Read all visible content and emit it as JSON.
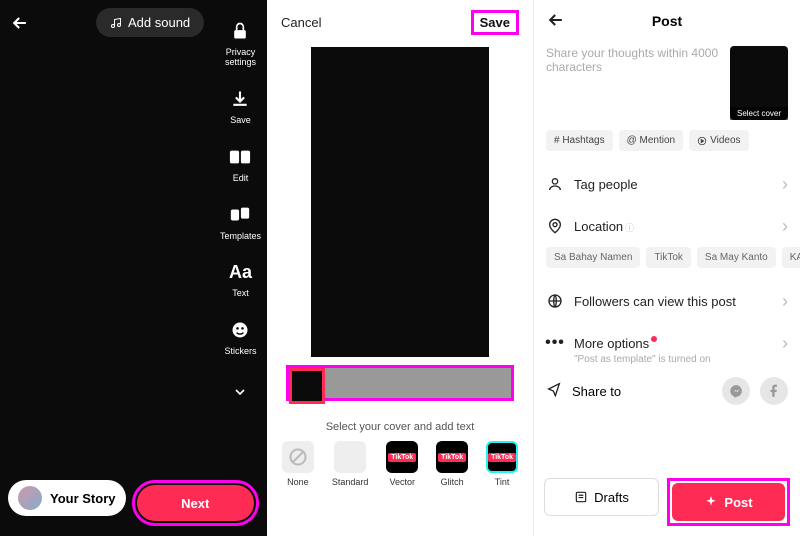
{
  "editor": {
    "add_sound": "Add sound",
    "sidebar": [
      {
        "icon": "lock",
        "label": "Privacy\nsettings"
      },
      {
        "icon": "download",
        "label": "Save"
      },
      {
        "icon": "scissors",
        "label": "Edit"
      },
      {
        "icon": "template",
        "label": "Templates"
      },
      {
        "icon": "text",
        "label": "Text"
      },
      {
        "icon": "sticker",
        "label": "Stickers"
      }
    ],
    "your_story": "Your Story",
    "next": "Next"
  },
  "cover": {
    "cancel": "Cancel",
    "save": "Save",
    "hint": "Select your cover and add text",
    "styles": [
      {
        "name": "None"
      },
      {
        "name": "Standard"
      },
      {
        "name": "Vector",
        "tt": true
      },
      {
        "name": "Glitch",
        "tt": true
      },
      {
        "name": "Tint",
        "tt": true,
        "selected": true
      }
    ]
  },
  "post": {
    "title": "Post",
    "placeholder": "Share your thoughts within 4000 characters",
    "select_cover": "Select cover",
    "chips": {
      "hashtags": "# Hashtags",
      "mention": "@ Mention",
      "videos": "Videos"
    },
    "tag_people": "Tag people",
    "location": "Location",
    "loc_suggestions": [
      "Sa Bahay Namen",
      "TikTok",
      "Sa May Kanto",
      "KAHIT S"
    ],
    "followers": "Followers can view this post",
    "more_options": "More options",
    "more_sub": "\"Post as template\" is turned on",
    "share_to": "Share to",
    "drafts": "Drafts",
    "post_btn": "Post"
  }
}
